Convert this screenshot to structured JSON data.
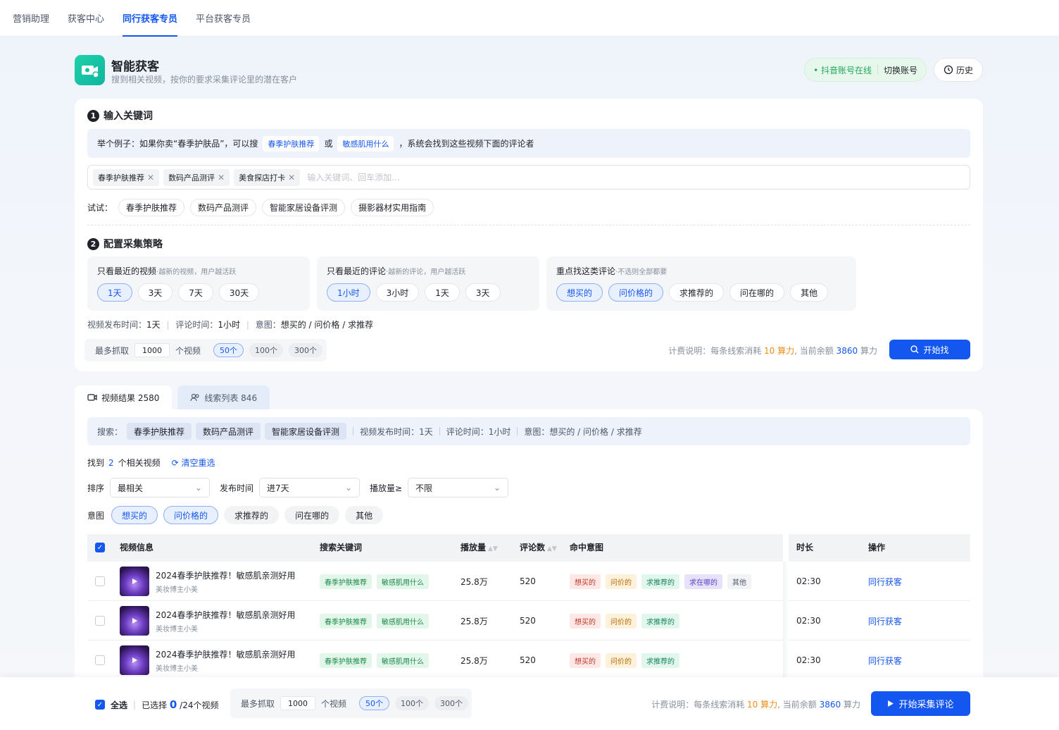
{
  "nav": {
    "tabs": [
      "营销助理",
      "获客中心",
      "同行获客专员",
      "平台获客专员"
    ],
    "active": 2
  },
  "header": {
    "title": "智能获客",
    "subtitle": "搜到相关视频，按你的要求采集评论里的潜在客户",
    "account_status": "抖音账号在线",
    "switch_account": "切换账号",
    "history": "历史"
  },
  "step1": {
    "num": "1",
    "title": "输入关键词",
    "example_prefix": "举个例子：如果你卖“春季护肤品”，可以搜",
    "example_chip1": "春季护肤推荐",
    "example_or": "或",
    "example_chip2": "敏感肌用什么",
    "example_suffix": "，系统会找到这些视频下面的评论者",
    "keywords": [
      "春季护肤推荐",
      "数码产品测评",
      "美食探店打卡"
    ],
    "input_placeholder": "输入关键词、回车添加...",
    "try_label": "试试：",
    "suggestions": [
      "春季护肤推荐",
      "数码产品测评",
      "智能家居设备评测",
      "摄影器材实用指南"
    ]
  },
  "step2": {
    "num": "2",
    "title": "配置采集策略",
    "groups": [
      {
        "label": "只看最近的视频",
        "hint": "·越新的视频，用户越活跃",
        "options": [
          "1天",
          "3天",
          "7天",
          "30天"
        ],
        "selected": [
          0
        ]
      },
      {
        "label": "只看最近的评论",
        "hint": "·越新的评论，用户越活跃",
        "options": [
          "1小时",
          "3小时",
          "1天",
          "3天"
        ],
        "selected": [
          0
        ]
      },
      {
        "label": "重点找这类评论",
        "hint": "·不选则全部都要",
        "options": [
          "想买的",
          "问价格的",
          "求推荐的",
          "问在哪的",
          "其他"
        ],
        "selected": [
          0,
          1
        ]
      }
    ],
    "summary": {
      "video_label": "视频发布时间：",
      "video_val": "1天",
      "comment_label": "评论时间：",
      "comment_val": "1小时",
      "intent_label": "意图：",
      "intent_val": "想买的 / 问价格 / 求推荐"
    },
    "grab": {
      "prefix": "最多抓取",
      "value": "1000",
      "suffix": "个视频",
      "counts": [
        "50个",
        "100个",
        "300个"
      ],
      "selected": 0
    },
    "fee": {
      "prefix": "计费说明：每条线索消耗",
      "cost": "10 算力",
      "mid": ", 当前余额",
      "balance": "3860",
      "suffix": "算力"
    },
    "start_btn": "开始找"
  },
  "results": {
    "tabs": [
      {
        "label": "视频结果 2580"
      },
      {
        "label": "线索列表 846"
      }
    ],
    "search_label": "搜索：",
    "search_tags": [
      "春季护肤推荐",
      "数码产品测评",
      "智能家居设备评测"
    ],
    "search_meta": [
      "视频发布时间：1天",
      "评论时间：1小时",
      "意图：想买的 / 问价格 / 求推荐"
    ],
    "found_prefix": "找到",
    "found_count": "2",
    "found_suffix": "个相关视频",
    "clear": "清空重选",
    "filters": {
      "sort_label": "排序",
      "sort_val": "最相关",
      "time_label": "发布时间",
      "time_val": "进7天",
      "play_label": "播放量≥",
      "play_val": "不限"
    },
    "intent_label": "意图",
    "intents": [
      "想买的",
      "问价格的",
      "求推荐的",
      "问在哪的",
      "其他"
    ],
    "intent_selected": [
      0,
      1
    ],
    "columns": {
      "info": "视频信息",
      "keyword": "搜索关键词",
      "plays": "播放量",
      "comments": "评论数",
      "intent": "命中意图",
      "duration": "时长",
      "action": "操作"
    },
    "rows": [
      {
        "title": "2024春季护肤推荐！敏感肌亲测好用",
        "author": "美妆博主小美",
        "keywords": [
          "春季护肤推荐",
          "敏感肌用什么"
        ],
        "plays": "25.8万",
        "comments": "520",
        "intents": [
          {
            "t": "想买的",
            "c": "r"
          },
          {
            "t": "问价的",
            "c": "y"
          },
          {
            "t": "求推荐的",
            "c": "g"
          },
          {
            "t": "求在哪的",
            "c": "p"
          },
          {
            "t": "其他",
            "c": "n"
          }
        ],
        "duration": "02:30",
        "action": "同行获客"
      },
      {
        "title": "2024春季护肤推荐！敏感肌亲测好用",
        "author": "美妆博主小美",
        "keywords": [
          "春季护肤推荐",
          "敏感肌用什么"
        ],
        "plays": "25.8万",
        "comments": "520",
        "intents": [
          {
            "t": "想买的",
            "c": "r"
          },
          {
            "t": "问价的",
            "c": "y"
          },
          {
            "t": "求推荐的",
            "c": "g"
          }
        ],
        "duration": "02:30",
        "action": "同行获客"
      },
      {
        "title": "2024春季护肤推荐！敏感肌亲测好用",
        "author": "美妆博主小美",
        "keywords": [
          "春季护肤推荐",
          "敏感肌用什么"
        ],
        "plays": "25.8万",
        "comments": "520",
        "intents": [
          {
            "t": "想买的",
            "c": "r"
          },
          {
            "t": "问价的",
            "c": "y"
          },
          {
            "t": "求推荐的",
            "c": "g"
          }
        ],
        "duration": "02:30",
        "action": "同行获客"
      }
    ]
  },
  "bottom": {
    "select_all": "全选",
    "selected_prefix": "已选择",
    "selected_count": "0",
    "selected_suffix": "/24个视频",
    "grab_prefix": "最多抓取",
    "grab_value": "1000",
    "grab_suffix": "个视频",
    "counts": [
      "50个",
      "100个",
      "300个"
    ],
    "selected": 0,
    "fee": {
      "prefix": "计费说明：每条线索消耗",
      "cost": "10 算力",
      "mid": ", 当前余额",
      "balance": "3860",
      "suffix": "算力"
    },
    "start_btn": "开始采集评论"
  },
  "colors": {
    "accent": "#1456f0",
    "online": "#1ea85a",
    "cost": "#ef8d16"
  }
}
